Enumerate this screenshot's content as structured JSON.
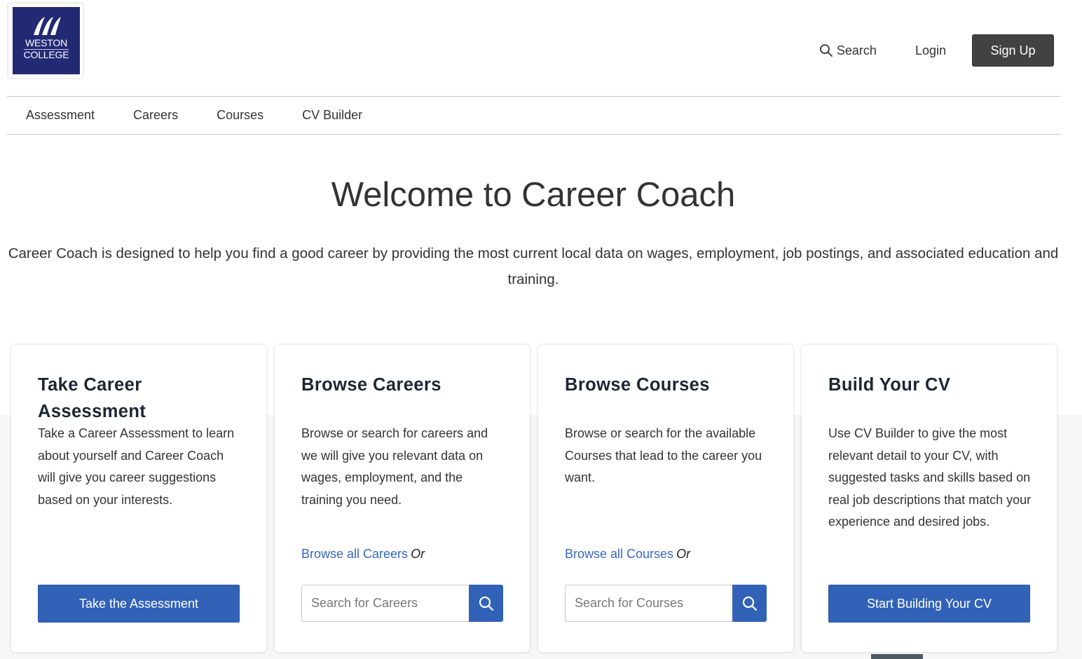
{
  "header": {
    "logo": {
      "line1": "WESTON",
      "line2": "COLLEGE",
      "brand_color": "#232a74"
    },
    "search_label": "Search",
    "login_label": "Login",
    "signup_label": "Sign Up"
  },
  "nav": {
    "items": [
      {
        "label": "Assessment"
      },
      {
        "label": "Careers"
      },
      {
        "label": "Courses"
      },
      {
        "label": "CV Builder"
      }
    ]
  },
  "hero": {
    "title": "Welcome to Career Coach",
    "intro": "Career Coach is designed to help you find a good career by providing the most current local data on wages, employment, job postings, and associated education and training."
  },
  "cards": [
    {
      "title": "Take Career Assessment",
      "description": "Take a Career Assessment to learn about yourself and Career Coach will give you career suggestions based on your interests.",
      "button_label": "Take the Assessment"
    },
    {
      "title": "Browse Careers",
      "description": "Browse or search for careers and we will give you relevant data on wages, employment, and the training you need.",
      "link_label": "Browse all Careers",
      "or_label": "Or",
      "search_placeholder": "Search for Careers"
    },
    {
      "title": "Browse Courses",
      "description": "Browse or search for the available Courses that lead to the career you want.",
      "link_label": "Browse all Courses",
      "or_label": "Or",
      "search_placeholder": "Search for Courses"
    },
    {
      "title": "Build Your CV",
      "description": "Use CV Builder to give the most relevant detail to your CV, with suggested tasks and skills based on real job descriptions that match your experience and desired jobs.",
      "button_label": "Start Building Your CV"
    }
  ],
  "colors": {
    "primary_button": "#3262b7",
    "link": "#3766bf",
    "signup_button": "#424242"
  }
}
